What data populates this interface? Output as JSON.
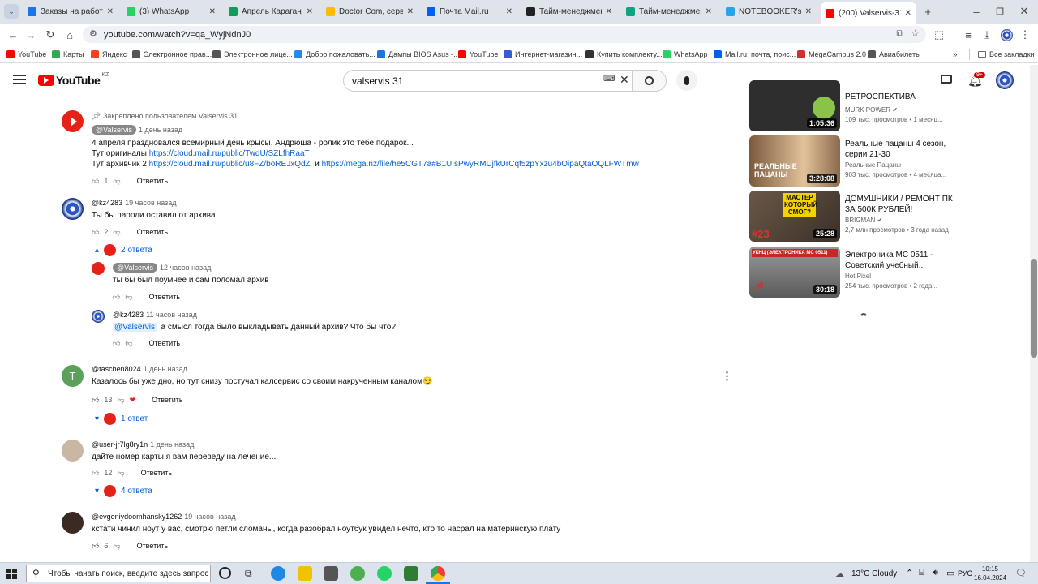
{
  "browser": {
    "tabs": [
      {
        "title": "Заказы на работу | F",
        "color": "#1a73e8"
      },
      {
        "title": "(3) WhatsApp",
        "color": "#25d366"
      },
      {
        "title": "Апрель Караганда - ",
        "color": "#0f9d58"
      },
      {
        "title": "Doctor Com, сервис -",
        "color": "#fbbc04"
      },
      {
        "title": "Почта Mail.ru",
        "color": "#005ff9"
      },
      {
        "title": "Тайм-менеджмент -",
        "color": "#222222"
      },
      {
        "title": "Тайм-менеджмент -",
        "color": "#10a37f"
      },
      {
        "title": "NOTEBOOKER's chat",
        "color": "#2aa3e8"
      },
      {
        "title": "(200) Valservis-31. Br",
        "color": "#ff0000"
      }
    ],
    "url": "youtube.com/watch?v=qa_WyjNdnJ0",
    "bookmarks": [
      {
        "label": "YouTube",
        "color": "#ff0000"
      },
      {
        "label": "Карты",
        "color": "#34a853"
      },
      {
        "label": "Яндекс",
        "color": "#fc3f1d"
      },
      {
        "label": "Электронное прав...",
        "color": "#555555"
      },
      {
        "label": "Электронное лице...",
        "color": "#555555"
      },
      {
        "label": "Добро пожаловать...",
        "color": "#2787f5"
      },
      {
        "label": "Дампы BIOS Asus -...",
        "color": "#1a73e8"
      },
      {
        "label": "YouTube",
        "color": "#ff0000"
      },
      {
        "label": "Интернет-магазин...",
        "color": "#3a57d6"
      },
      {
        "label": "Купить комплекту...",
        "color": "#333333"
      },
      {
        "label": "WhatsApp",
        "color": "#25d366"
      },
      {
        "label": "Mail.ru: почта, поис...",
        "color": "#005ff9"
      },
      {
        "label": "MegaCampus 2.0",
        "color": "#d42e2e"
      },
      {
        "label": "Авиабилеты",
        "color": "#555555"
      }
    ],
    "all_bookmarks": "Все закладки"
  },
  "youtube": {
    "logo": "YouTube",
    "region": "KZ",
    "search_value": "valservis 31",
    "notif_count": "9+"
  },
  "comments": [
    {
      "pinned": "Закреплено пользователем Valservis 31",
      "author": "@Valservis",
      "time": "1 день назад",
      "lines": [
        "4 апреля праздновался всемирный день крысы, Андрюша  - ролик это тебе подарок...",
        "Тут оригиналы",
        "Тут архивчик 2"
      ],
      "link1": "https://cloud.mail.ru/public/TwdU/SZLfhRaaT",
      "link2": "https://cloud.mail.ru/public/u8FZ/boREJxQdZ",
      "and": "и",
      "link3": "https://mega.nz/file/he5CGT7a#B1U!sPwyRMUjfkUrCqf5zpYxzu4bOipaQtaOQLFWTmw",
      "likes": "1",
      "reply": "Ответить"
    },
    {
      "author": "@kz4283",
      "time": "19 часов назад",
      "text": "Ты бы пароли оставил от архива",
      "likes": "2",
      "reply": "Ответить",
      "replies_label": "2 ответа"
    },
    {
      "author": "@Valservis",
      "time": "12 часов назад",
      "text": "ты бы был поумнее и сам поломал архив",
      "reply": "Ответить"
    },
    {
      "author": "@kz4283",
      "time": "11 часов назад",
      "mention": "@Valservis",
      "text": "а смысл тогда было выкладывать данный архив? Что бы что?",
      "reply": "Ответить"
    },
    {
      "author": "@taschen8024",
      "time": "1 день назад",
      "avatar_letter": "T",
      "text": "Казалось бы уже дно, но тут снизу постучал калсервис со своим накрученным каналом",
      "emoji": "😏",
      "likes": "13",
      "reply": "Ответить",
      "replies_label": "1 ответ"
    },
    {
      "author": "@user-jr7lg8ry1n",
      "time": "1 день назад",
      "text": "дайте номер карты я вам переведу на лечение...",
      "likes": "12",
      "reply": "Ответить",
      "replies_label": "4 ответа"
    },
    {
      "author": "@evgeniydoomhansky1262",
      "time": "19 часов назад",
      "text": "кстати чинил ноут у вас, смотрю петли  сломаны, когда разобрал ноутбук увидел нечто, кто то насрал на материнскую плату",
      "likes": "6",
      "reply": "Ответить"
    }
  ],
  "sidebar_videos": [
    {
      "title": "РЕТРОСПЕКТИВА",
      "channel": "MURK POWER",
      "views": "109 тыс. просмотров",
      "age": "1 месяц...",
      "duration": "1:05:36",
      "thumb": "#3a3a3a"
    },
    {
      "title": "Реальные пацаны 4 сезон, серии 21-30",
      "channel": "Реальные Пацаны",
      "views": "903 тыс. просмотров",
      "age": "4 месяца...",
      "duration": "3:28:08",
      "thumb": "#b07a48",
      "overlay": "РЕАЛЬНЫЕ ПАЦАНЫ"
    },
    {
      "title": "ДОМУШНИКИ / РЕМОНТ ПК ЗА 500К РУБЛЕЙ!",
      "channel": "BRIGMAN",
      "views": "2,7 млн просмотров",
      "age": "3 года назад",
      "duration": "25:28",
      "thumb": "#5a4a3a",
      "overlay": "МАСТЕР КОТОРЫЙ СМОГ?",
      "badge": "#23"
    },
    {
      "title": "Электроника МС 0511 - Советский учебный...",
      "channel": "Hot Pixel",
      "views": "254 тыс. просмотров",
      "age": "2 года...",
      "duration": "30:18",
      "thumb": "#8a8a8a",
      "overlay": "УКНЦ (ЭЛЕКТРОНИКА МС 0511)"
    }
  ],
  "taskbar": {
    "search_placeholder": "Чтобы начать поиск, введите здесь запрос",
    "weather": "13°C  Cloudy",
    "lang": "РУС",
    "time": "10:15",
    "date": "16.04.2024"
  }
}
